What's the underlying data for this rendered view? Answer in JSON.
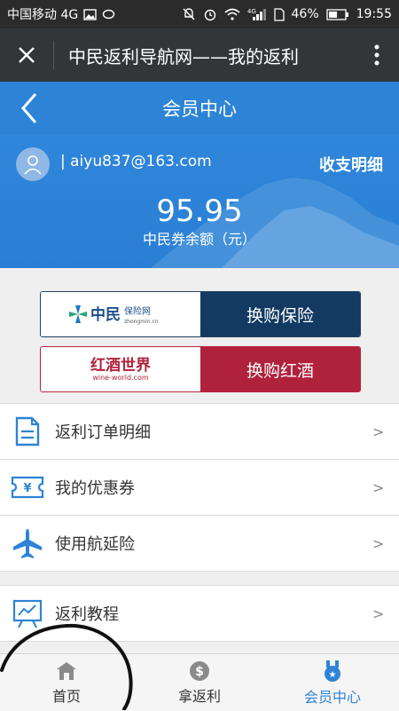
{
  "statusbar": {
    "carrier": "中国移动 4G",
    "net": "4G",
    "battery": "46%",
    "time": "19:55"
  },
  "topbar": {
    "title": "中民返利导航网——我的返利"
  },
  "header": {
    "title": "会员中心"
  },
  "profile": {
    "email": "| aiyu837@163.com",
    "detail_link": "收支明细",
    "balance": "95.95",
    "balance_label": "中民券余额（元）"
  },
  "exchange": [
    {
      "logo_text": "中民",
      "logo_sub": "保险网",
      "logo_domain": "zhongmin.cn",
      "action": "换购保险"
    },
    {
      "logo_text": "红酒世界",
      "logo_domain": "wine-world.com",
      "action": "换购红酒"
    }
  ],
  "menu": [
    {
      "label": "返利订单明细",
      "icon": "document-icon"
    },
    {
      "label": "我的优惠券",
      "icon": "coupon-icon"
    },
    {
      "label": "使用航延险",
      "icon": "airplane-icon"
    },
    {
      "label": "返利教程",
      "icon": "tutorial-chart-icon"
    }
  ],
  "chevron": ">",
  "tabs": [
    {
      "label": "首页",
      "icon": "home-icon",
      "active": false
    },
    {
      "label": "拿返利",
      "icon": "dollar-coin-icon",
      "active": false
    },
    {
      "label": "会员中心",
      "icon": "member-badge-icon",
      "active": true
    }
  ],
  "colors": {
    "brand_blue": "#2d84d6",
    "navy": "#133a63",
    "wine_red": "#b0223b"
  }
}
